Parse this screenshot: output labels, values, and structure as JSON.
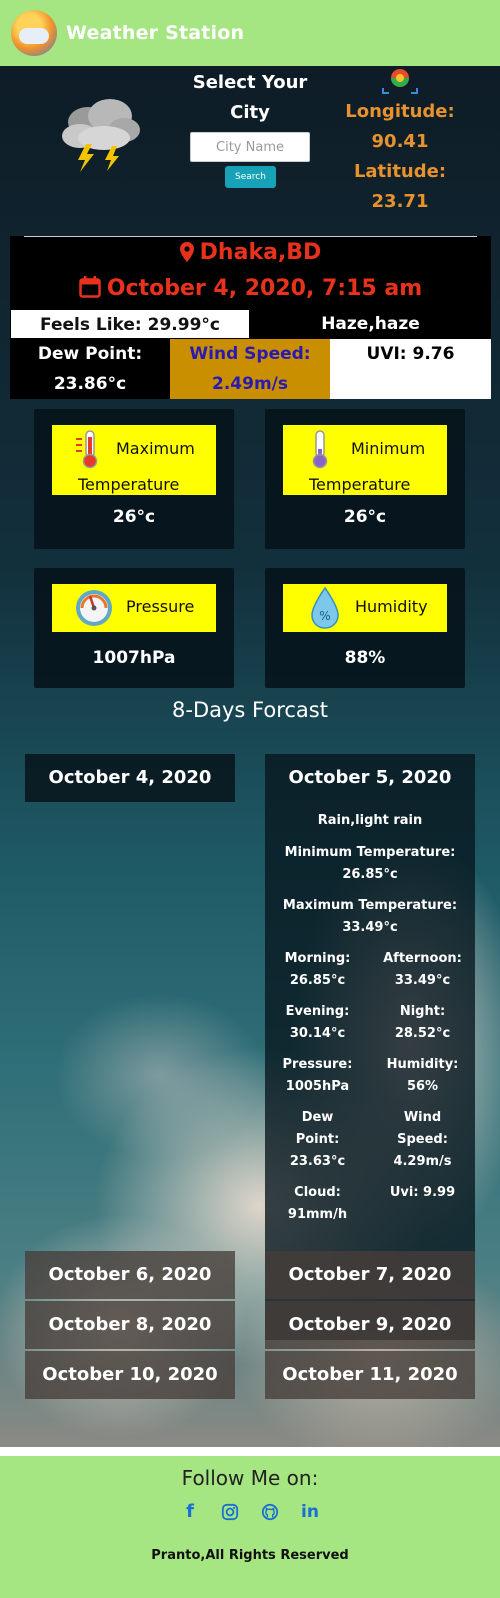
{
  "header": {
    "title": "Weather Station",
    "logo_icon": "weather-logo-icon"
  },
  "search": {
    "title_line1": "Select Your",
    "title_line2": "City",
    "placeholder": "City Name",
    "button_label": "Search"
  },
  "coords": {
    "longitude_label": "Longitude:",
    "longitude_value": "90.41",
    "latitude_label": "Latitude:",
    "latitude_value": "23.71"
  },
  "current": {
    "location": "Dhaka,BD",
    "datetime": "October 4, 2020, 7:15 am",
    "feels_like": "Feels Like: 29.99°c",
    "condition": "Haze,haze",
    "dew_label": "Dew Point:",
    "dew_value": "23.86°c",
    "wind_label": "Wind Speed:",
    "wind_value": "2.49m/s",
    "uvi": "UVI: 9.76"
  },
  "stats": {
    "max_label1": "Maximum",
    "max_label2": "Temperature",
    "max_value": "26°c",
    "min_label1": "Minimum",
    "min_label2": "Temperature",
    "min_value": "26°c",
    "pressure_label": "Pressure",
    "pressure_value": "1007hPa",
    "humidity_label": "Humidity",
    "humidity_value": "88%"
  },
  "forecast": {
    "title": "8-Days Forcast",
    "days": [
      "October 4, 2020",
      "October 5, 2020",
      "October 6, 2020",
      "October 7, 2020",
      "October 8, 2020",
      "October 9, 2020",
      "October 10, 2020",
      "October 11, 2020"
    ],
    "detail": {
      "condition": "Rain,light rain",
      "min_label": "Minimum Temperature:",
      "min_value": "26.85°c",
      "max_label": "Maximum Temperature:",
      "max_value": "33.49°c",
      "morning_label": "Morning:",
      "morning_value": "26.85°c",
      "afternoon_label": "Afternoon:",
      "afternoon_value": "33.49°c",
      "evening_label": "Evening:",
      "evening_value": "30.14°c",
      "night_label": "Night:",
      "night_value": "28.52°c",
      "pressure_label": "Pressure:",
      "pressure_value": "1005hPa",
      "humidity_label": "Humidity:",
      "humidity_value": "56%",
      "dew_label1": "Dew",
      "dew_label2": "Point:",
      "dew_value": "23.63°c",
      "wind_label1": "Wind",
      "wind_label2": "Speed:",
      "wind_value": "4.29m/s",
      "cloud_label": "Cloud:",
      "cloud_value": "91mm/h",
      "uvi": "Uvi: 9.99"
    }
  },
  "footer": {
    "follow": "Follow Me on:",
    "socials": [
      "facebook-icon",
      "instagram-icon",
      "github-icon",
      "linkedin-icon"
    ],
    "rights": "Pranto,All Rights Reserved"
  },
  "colors": {
    "brand_green": "#a5e682",
    "location_red": "#e8321c",
    "coords_orange": "#e8922e",
    "wind_bg": "#c98f00",
    "pill_yellow": "#ffff00",
    "search_button": "#17a2b8"
  }
}
